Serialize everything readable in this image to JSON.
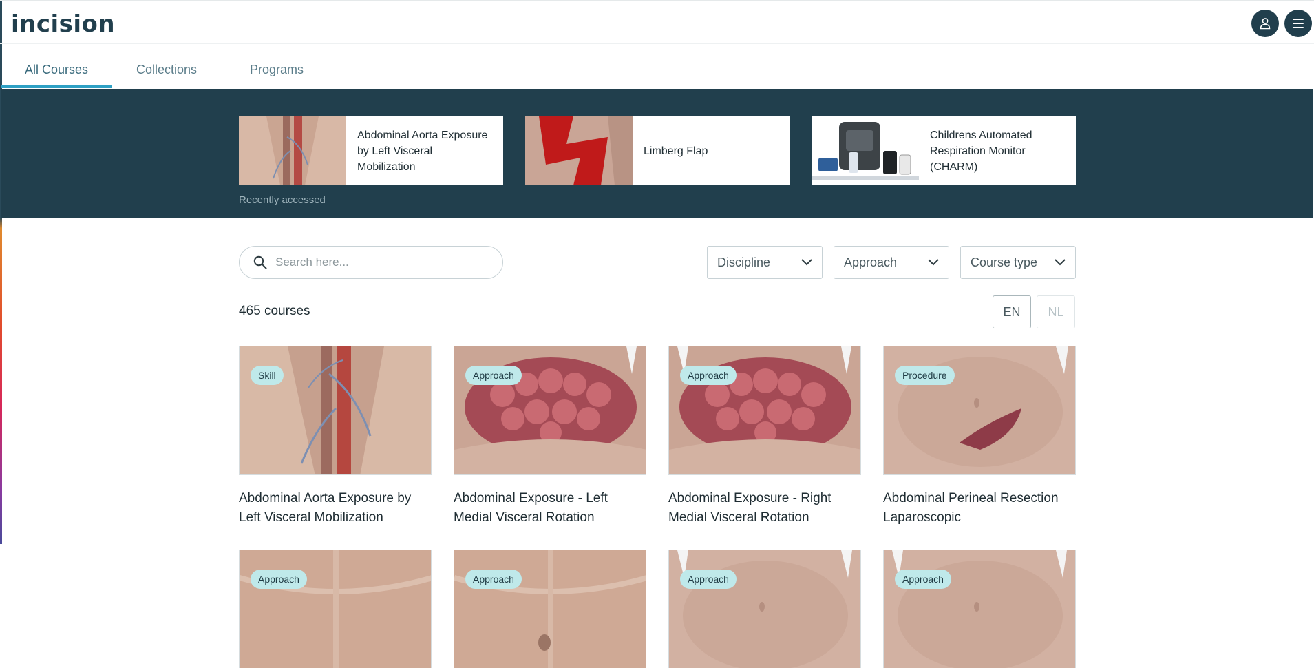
{
  "header": {
    "logo_text": "incision",
    "user_icon": "user-icon",
    "menu_icon": "hamburger-menu-icon",
    "brand_color": "#213f4d"
  },
  "tabs": [
    {
      "label": "All Courses",
      "active": true
    },
    {
      "label": "Collections",
      "active": false
    },
    {
      "label": "Programs",
      "active": false
    }
  ],
  "recent": {
    "caption": "Recently accessed",
    "items": [
      {
        "title": "Abdominal Aorta Exposure by Left Visceral Mobilization"
      },
      {
        "title": "Limberg Flap"
      },
      {
        "title": "Childrens Automated Respiration Monitor (CHARM)"
      }
    ]
  },
  "search": {
    "placeholder": "Search here...",
    "value": ""
  },
  "filters": [
    {
      "label": "Discipline"
    },
    {
      "label": "Approach"
    },
    {
      "label": "Course type"
    }
  ],
  "course_count": "465 courses",
  "languages": [
    {
      "label": "EN",
      "selected": true
    },
    {
      "label": "NL",
      "selected": false
    }
  ],
  "courses": [
    {
      "badge": "Skill",
      "title": "Abdominal Aorta Exposure by Left Visceral Mobilization"
    },
    {
      "badge": "Approach",
      "title": "Abdominal Exposure - Left Medial Visceral Rotation"
    },
    {
      "badge": "Approach",
      "title": "Abdominal Exposure - Right Medial Visceral Rotation"
    },
    {
      "badge": "Procedure",
      "title": "Abdominal Perineal Resection Laparoscopic"
    },
    {
      "badge": "Approach",
      "title": ""
    },
    {
      "badge": "Approach",
      "title": ""
    },
    {
      "badge": "Approach",
      "title": ""
    },
    {
      "badge": "Approach",
      "title": ""
    }
  ],
  "colors": {
    "accent": "#2ea0c4",
    "badge_bg": "#bfe9ea",
    "hero_bg": "#213f4d"
  }
}
